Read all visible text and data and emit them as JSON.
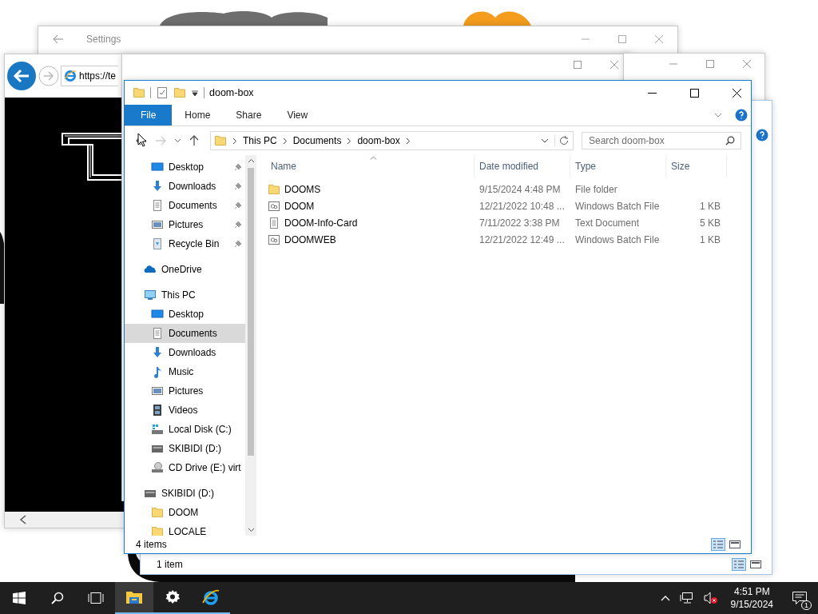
{
  "settings_window": {
    "title": "Settings"
  },
  "browser_window": {
    "address": "https://te"
  },
  "explorer": {
    "title": "doom-box",
    "ribbon_tabs": [
      {
        "label": "File",
        "selected": true
      },
      {
        "label": "Home",
        "selected": false
      },
      {
        "label": "Share",
        "selected": false
      },
      {
        "label": "View",
        "selected": false
      }
    ],
    "breadcrumbs": [
      "This PC",
      "Documents",
      "doom-box"
    ],
    "search": {
      "placeholder": "Search doom-box"
    },
    "quick_access": [
      {
        "label": "Desktop",
        "kind": "desktop",
        "pinned": true,
        "selected": false
      },
      {
        "label": "Downloads",
        "kind": "downloads",
        "pinned": true,
        "selected": false
      },
      {
        "label": "Documents",
        "kind": "documents",
        "pinned": true,
        "selected": false
      },
      {
        "label": "Pictures",
        "kind": "pictures",
        "pinned": true,
        "selected": false
      },
      {
        "label": "Recycle Bin",
        "kind": "recycle",
        "pinned": true,
        "selected": false
      }
    ],
    "nav": [
      {
        "label": "OneDrive",
        "kind": "onedrive",
        "selected": false
      },
      {
        "label": "This PC",
        "kind": "pc",
        "selected": false,
        "children": [
          {
            "label": "Desktop",
            "kind": "desktop",
            "selected": false
          },
          {
            "label": "Documents",
            "kind": "documents",
            "selected": true
          },
          {
            "label": "Downloads",
            "kind": "downloads",
            "selected": false
          },
          {
            "label": "Music",
            "kind": "music",
            "selected": false
          },
          {
            "label": "Pictures",
            "kind": "pictures",
            "selected": false
          },
          {
            "label": "Videos",
            "kind": "videos",
            "selected": false
          },
          {
            "label": "Local Disk (C:)",
            "kind": "disk",
            "selected": false
          },
          {
            "label": "SKIBIDI (D:)",
            "kind": "drive",
            "selected": false
          },
          {
            "label": "CD Drive (E:) virt",
            "kind": "cd",
            "selected": false
          }
        ]
      },
      {
        "label": "SKIBIDI (D:)",
        "kind": "drive",
        "selected": false,
        "children": [
          {
            "label": "DOOM",
            "kind": "folder",
            "selected": false
          },
          {
            "label": "LOCALE",
            "kind": "folder",
            "selected": false
          }
        ]
      }
    ],
    "columns": [
      {
        "label": "Name",
        "sorted": true
      },
      {
        "label": "Date modified",
        "sorted": false
      },
      {
        "label": "Type",
        "sorted": false
      },
      {
        "label": "Size",
        "sorted": false
      }
    ],
    "rows": [
      {
        "kind": "folder",
        "name": "DOOMS",
        "date": "9/15/2024 4:48 PM",
        "type": "File folder"
      },
      {
        "kind": "batch",
        "name": "DOOM",
        "date": "12/21/2022 10:48 ...",
        "type": "Windows Batch File",
        "size": "1 KB"
      },
      {
        "kind": "text",
        "name": "DOOM-Info-Card",
        "date": "7/11/2022 3:38 PM",
        "type": "Text Document",
        "size": "5 KB"
      },
      {
        "kind": "batch",
        "name": "DOOMWEB",
        "date": "12/21/2022 12:49 ...",
        "type": "Windows Batch File",
        "size": "1 KB"
      }
    ],
    "status": "4 items"
  },
  "back_explorer": {
    "status": "1 item"
  },
  "taskbar": {
    "apps": [
      {
        "kind": "explorer",
        "selected": true,
        "running": true
      },
      {
        "kind": "settings",
        "selected": false,
        "running": true
      },
      {
        "kind": "ie",
        "selected": false,
        "running": true
      }
    ],
    "volume_muted": true,
    "time": "4:51 PM",
    "date": "9/15/2024",
    "notifications": "1"
  }
}
